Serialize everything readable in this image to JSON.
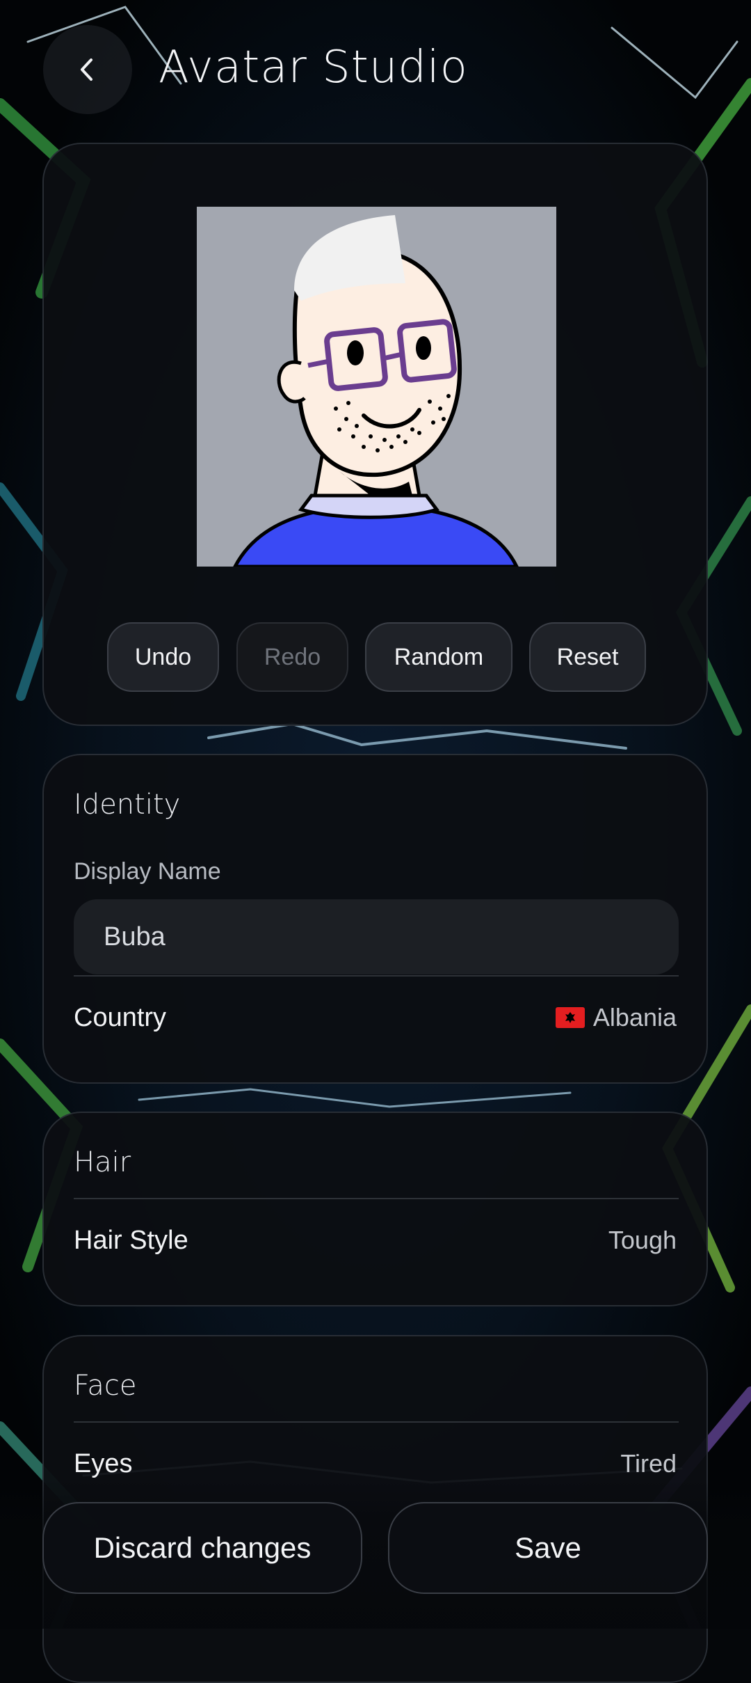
{
  "header": {
    "title": "Avatar Studio",
    "back_icon": "chevron-left-icon"
  },
  "avatar": {
    "background_color": "#a3a7b0",
    "hair_color": "#f1f1f1",
    "skin_color": "#fdeee2",
    "glasses_color": "#6a3d8f",
    "shirt_color": "#3a4af5",
    "collar_color": "#d4d5f7"
  },
  "actions": {
    "undo": "Undo",
    "redo": "Redo",
    "random": "Random",
    "reset": "Reset"
  },
  "identity": {
    "title": "Identity",
    "display_name_label": "Display Name",
    "display_name_value": "Buba",
    "country_label": "Country",
    "country_value": "Albania",
    "country_flag_color": "#e41e20"
  },
  "hair": {
    "title": "Hair",
    "style_label": "Hair Style",
    "style_value": "Tough"
  },
  "face": {
    "title": "Face",
    "eyes_label": "Eyes",
    "eyes_value": "Tired"
  },
  "footer": {
    "discard_label": "Discard changes",
    "save_label": "Save"
  }
}
